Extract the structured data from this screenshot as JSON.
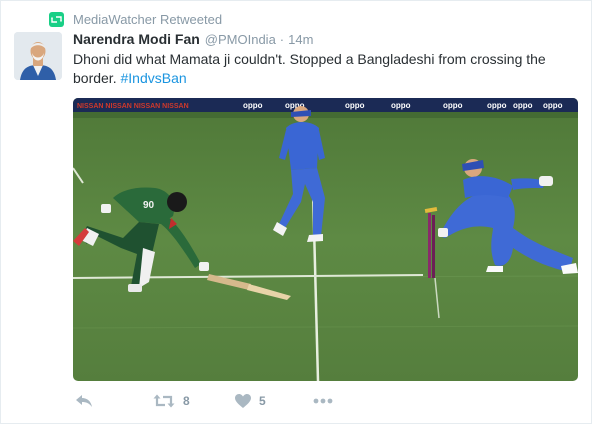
{
  "retweet_context": {
    "icon": "retweet-icon",
    "text": "MediaWatcher Retweeted",
    "color": "#19cf86"
  },
  "tweet": {
    "author_name": "Narendra Modi Fan",
    "author_handle": "@PMOIndia",
    "separator": "·",
    "time": "14m",
    "text": "Dhoni did what Mamata ji couldn't. Stopped a Bangladeshi from crossing the border. ",
    "hashtag": "#IndvsBan",
    "hashtag_color": "#1b95e0"
  },
  "media": {
    "boundary_texts": [
      "NISSAN NISSAN NISSAN NISSAN",
      "oppo",
      "oppo",
      "oppo",
      "oppo",
      "oppo",
      "oppo",
      "oppo",
      "oppo"
    ],
    "player_jersey_number": "90"
  },
  "actions": {
    "reply_icon": "reply-icon",
    "retweet_icon": "retweet-icon",
    "retweet_count": "8",
    "like_icon": "heart-icon",
    "like_count": "5",
    "more_icon": "more-icon"
  }
}
